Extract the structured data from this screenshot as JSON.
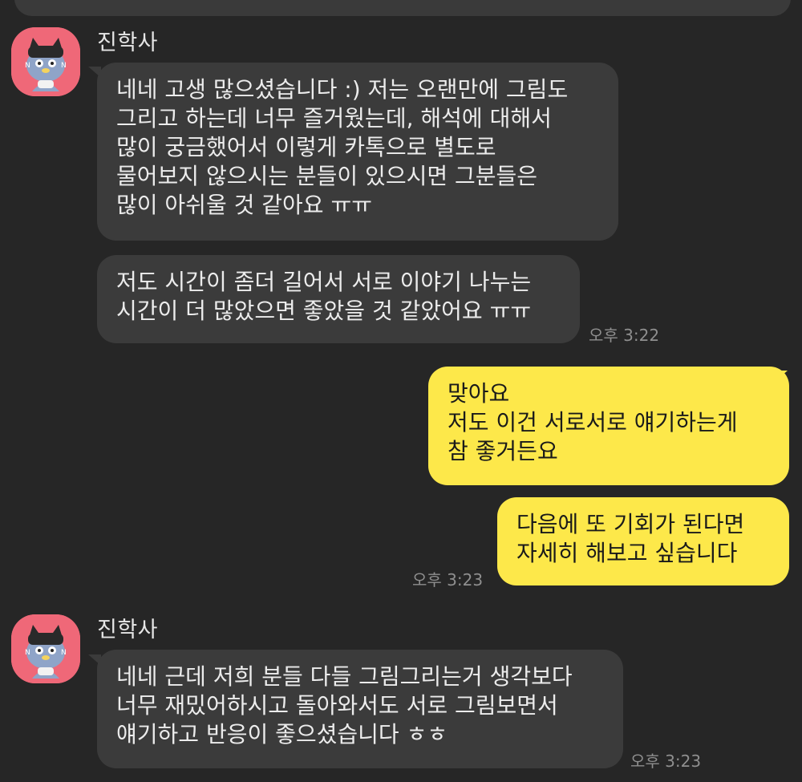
{
  "top_partial_bubble": "",
  "groups": [
    {
      "sender": "진학사",
      "avatar_icon": "kakao-cat-avatar-icon",
      "messages": [
        {
          "lines": [
            "네네 고생 많으셨습니다 :) 저는 오랜만에 그림도",
            "그리고 하는데 너무 즐거웠는데, 해석에 대해서",
            "많이 궁금했어서 이렇게 카톡으로 별도로",
            "물어보지 않으시는 분들이 있으시면 그분들은",
            "많이 아쉬울 것 같아요 ㅠㅠ"
          ]
        },
        {
          "lines": [
            "저도 시간이 좀더 길어서 서로 이야기 나누는",
            "시간이 더 많았으면 좋았을 것 같았어요 ㅠㅠ"
          ],
          "time": "오후 3:22"
        }
      ]
    },
    {
      "sender": "me",
      "messages": [
        {
          "lines": [
            "맞아요",
            "저도  이건 서로서로 얘기하는게",
            "참 좋거든요"
          ]
        },
        {
          "lines": [
            "다음에  또 기회가 된다면",
            "자세히 해보고 싶습니다"
          ],
          "time": "오후 3:23"
        }
      ]
    },
    {
      "sender": "진학사",
      "avatar_icon": "kakao-cat-avatar-icon",
      "messages": [
        {
          "lines": [
            "네네 근데 저희 분들 다들 그림그리는거 생각보다",
            "너무 재밌어하시고 돌아와서도 서로 그림보면서",
            "얘기하고 반응이 좋으셨습니다 ㅎㅎ"
          ],
          "time": "오후 3:23"
        }
      ]
    }
  ],
  "colors": {
    "background": "#262626",
    "incoming_bubble": "#3b3b3b",
    "outgoing_bubble": "#fde84a",
    "avatar_bg": "#ef6878"
  }
}
